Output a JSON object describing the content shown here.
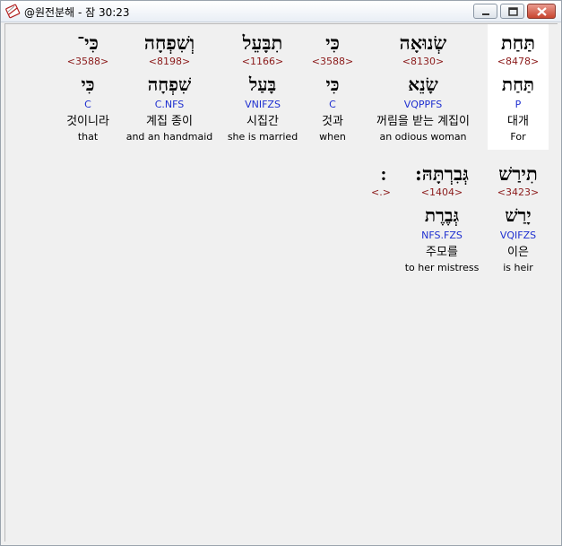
{
  "window": {
    "title": "@원전분해 - 잠 30:23"
  },
  "icons": {
    "app": "app-book-icon",
    "minimize": "minimize-icon",
    "maximize": "maximize-icon",
    "close": "close-icon"
  },
  "words": [
    {
      "heb": "תַּחַת",
      "strong": "<8478>",
      "lemma": "תַּחַת",
      "morph": "P",
      "korean": "대개",
      "english": "For",
      "selected": true
    },
    {
      "heb": "שְׂנוּאָה",
      "strong": "<8130>",
      "lemma": "שָׂנֵא",
      "morph": "VQPPFS",
      "korean": "꺼림을 받는 계집이",
      "english": "an odious woman",
      "selected": false
    },
    {
      "heb": "כִּי",
      "strong": "<3588>",
      "lemma": "כִּי",
      "morph": "C",
      "korean": "것과",
      "english": "when",
      "selected": false
    },
    {
      "heb": "תִבָּעֵל",
      "strong": "<1166>",
      "lemma": "בָּעַל",
      "morph": "VNIFZS",
      "korean": "시집간",
      "english": "she is married",
      "selected": false
    },
    {
      "heb": "וְשִׁפְחָה",
      "strong": "<8198>",
      "lemma": "שִׁפְחָה",
      "morph": "C.NFS",
      "korean": "계집 종이",
      "english": "and an handmaid",
      "selected": false
    },
    {
      "heb": "כִּי־",
      "strong": "<3588>",
      "lemma": "כִּי",
      "morph": "C",
      "korean": "것이니라",
      "english": "that",
      "selected": false
    },
    {
      "heb": "תִירַשׁ",
      "strong": "<3423>",
      "lemma": "יָרַשׁ",
      "morph": "VQIFZS",
      "korean": "이은",
      "english": "is heir",
      "selected": false
    },
    {
      "heb": "גְּבִרְתָּהּ:",
      "strong": "<1404>",
      "lemma": "גְּבֶרֶת",
      "morph": "NFS.FZS",
      "korean": "주모를",
      "english": "to her mistress",
      "selected": false
    },
    {
      "heb": "׃",
      "strong": "<.>",
      "lemma": "",
      "morph": "",
      "korean": "",
      "english": "",
      "selected": false
    }
  ]
}
